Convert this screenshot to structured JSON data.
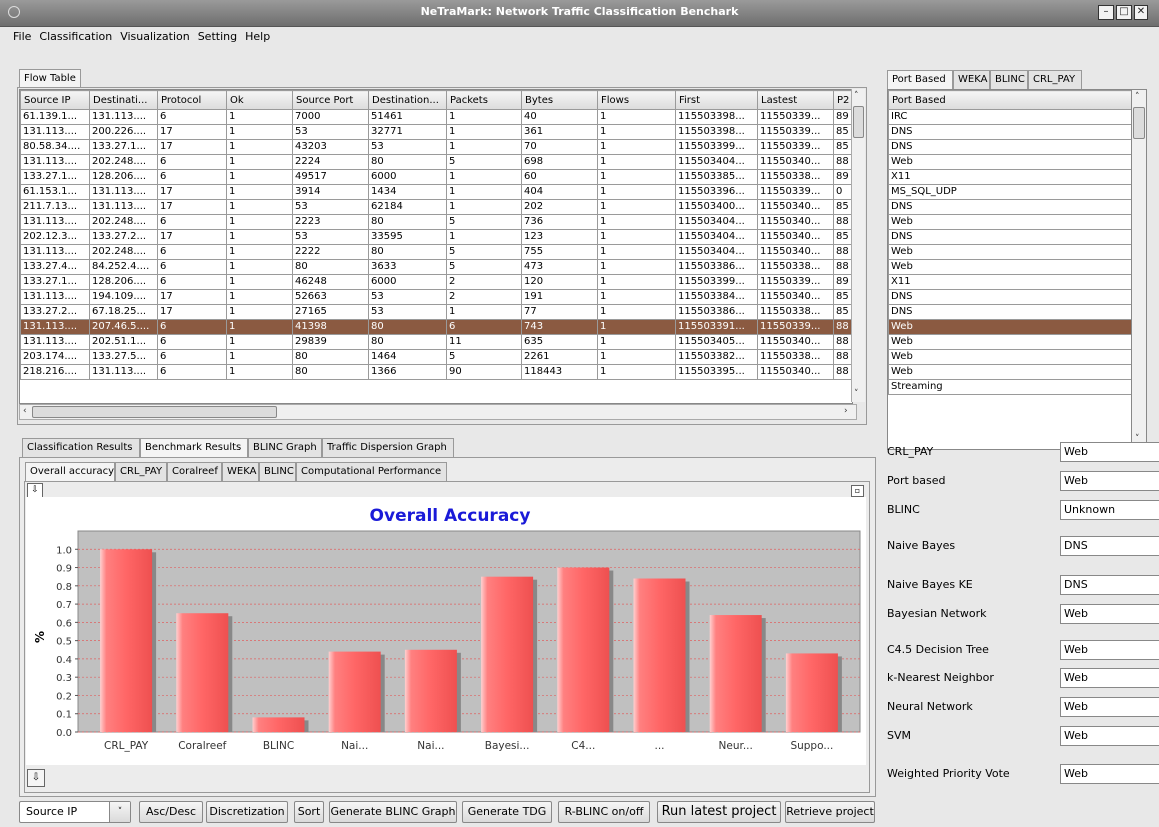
{
  "window": {
    "title": "NeTraMark: Network Traffic Classification Benchark"
  },
  "menu": [
    "File",
    "Classification",
    "Visualization",
    "Setting",
    "Help"
  ],
  "flow_table": {
    "tab": "Flow Table",
    "columns": [
      "Source IP",
      "Destinati...",
      "Protocol",
      "Ok",
      "Source Port",
      "Destination...",
      "Packets",
      "Bytes",
      "Flows",
      "First",
      "Lastest",
      "P2"
    ],
    "rows": [
      [
        "61.139.1...",
        "131.113....",
        "6",
        "1",
        "7000",
        "51461",
        "1",
        "40",
        "1",
        "115503398...",
        "11550339...",
        "89"
      ],
      [
        "131.113....",
        "200.226....",
        "17",
        "1",
        "53",
        "32771",
        "1",
        "361",
        "1",
        "115503398...",
        "11550339...",
        "85"
      ],
      [
        "80.58.34....",
        "133.27.1...",
        "17",
        "1",
        "43203",
        "53",
        "1",
        "70",
        "1",
        "115503399...",
        "11550339...",
        "85"
      ],
      [
        "131.113....",
        "202.248....",
        "6",
        "1",
        "2224",
        "80",
        "5",
        "698",
        "1",
        "115503404...",
        "11550340...",
        "88"
      ],
      [
        "133.27.1...",
        "128.206....",
        "6",
        "1",
        "49517",
        "6000",
        "1",
        "60",
        "1",
        "115503385...",
        "11550338...",
        "89"
      ],
      [
        "61.153.1...",
        "131.113....",
        "17",
        "1",
        "3914",
        "1434",
        "1",
        "404",
        "1",
        "115503396...",
        "11550339...",
        "0"
      ],
      [
        "211.7.13...",
        "131.113....",
        "17",
        "1",
        "53",
        "62184",
        "1",
        "202",
        "1",
        "115503400...",
        "11550340...",
        "85"
      ],
      [
        "131.113....",
        "202.248....",
        "6",
        "1",
        "2223",
        "80",
        "5",
        "736",
        "1",
        "115503404...",
        "11550340...",
        "88"
      ],
      [
        "202.12.3...",
        "133.27.2...",
        "17",
        "1",
        "53",
        "33595",
        "1",
        "123",
        "1",
        "115503404...",
        "11550340...",
        "85"
      ],
      [
        "131.113....",
        "202.248....",
        "6",
        "1",
        "2222",
        "80",
        "5",
        "755",
        "1",
        "115503404...",
        "11550340...",
        "88"
      ],
      [
        "133.27.4...",
        "84.252.4....",
        "6",
        "1",
        "80",
        "3633",
        "5",
        "473",
        "1",
        "115503386...",
        "11550338...",
        "88"
      ],
      [
        "133.27.1...",
        "128.206....",
        "6",
        "1",
        "46248",
        "6000",
        "2",
        "120",
        "1",
        "115503399...",
        "11550339...",
        "89"
      ],
      [
        "131.113....",
        "194.109....",
        "17",
        "1",
        "52663",
        "53",
        "2",
        "191",
        "1",
        "115503384...",
        "11550340...",
        "85"
      ],
      [
        "133.27.2...",
        "67.18.25...",
        "17",
        "1",
        "27165",
        "53",
        "1",
        "77",
        "1",
        "115503386...",
        "11550338...",
        "85"
      ],
      [
        "131.113....",
        "207.46.5....",
        "6",
        "1",
        "41398",
        "80",
        "6",
        "743",
        "1",
        "115503391...",
        "11550339...",
        "88"
      ],
      [
        "131.113....",
        "202.51.1...",
        "6",
        "1",
        "29839",
        "80",
        "11",
        "635",
        "1",
        "115503405...",
        "11550340...",
        "88"
      ],
      [
        "203.174....",
        "133.27.5...",
        "6",
        "1",
        "80",
        "1464",
        "5",
        "2261",
        "1",
        "115503382...",
        "11550338...",
        "88"
      ],
      [
        "218.216....",
        "131.113....",
        "6",
        "1",
        "80",
        "1366",
        "90",
        "118443",
        "1",
        "115503395...",
        "11550340...",
        "88"
      ]
    ],
    "selected_row": 14
  },
  "side_tabs": [
    "Port Based",
    "WEKA",
    "BLINC",
    "CRL_PAY"
  ],
  "port_based": {
    "header": "Port Based",
    "rows": [
      "IRC",
      "DNS",
      "DNS",
      "Web",
      "X11",
      "MS_SQL_UDP",
      "DNS",
      "Web",
      "DNS",
      "Web",
      "Web",
      "X11",
      "DNS",
      "DNS",
      "Web",
      "Web",
      "Web",
      "Web",
      "Streaming"
    ],
    "selected_row": 14
  },
  "results_tabs": [
    "Classification Results",
    "Benchmark Results",
    "BLINC Graph",
    "Traffic Dispersion Graph"
  ],
  "benchmark_tabs": [
    "Overall accuracy",
    "CRL_PAY",
    "Coralreef",
    "WEKA",
    "BLINC",
    "Computational Performance"
  ],
  "chart_data": {
    "type": "bar",
    "title": "Overall Accuracy",
    "xlabel": "",
    "ylabel": "%",
    "categories": [
      "CRL_PAY",
      "Coralreef",
      "BLINC",
      "Nai...",
      "Nai...",
      "Bayesi...",
      "C4...",
      "...",
      "Neur...",
      "Suppo..."
    ],
    "values": [
      1.0,
      0.65,
      0.08,
      0.44,
      0.45,
      0.85,
      0.9,
      0.84,
      0.64,
      0.43
    ],
    "yticks": [
      "0.0",
      "0.1",
      "0.2",
      "0.3",
      "0.4",
      "0.5",
      "0.6",
      "0.7",
      "0.8",
      "0.9",
      "1.0"
    ],
    "ylim": [
      0,
      1.1
    ],
    "grid": true,
    "bar_color": "#ff6666",
    "plot_background": "#c0c0c0"
  },
  "results_fields": [
    {
      "label": "CRL_PAY",
      "value": "Web"
    },
    {
      "label": "Port based",
      "value": "Web"
    },
    {
      "label": "BLINC",
      "value": "Unknown"
    },
    {
      "label": "Naive Bayes",
      "value": "DNS"
    },
    {
      "label": "Naive Bayes KE",
      "value": "DNS"
    },
    {
      "label": "Bayesian Network",
      "value": "Web"
    },
    {
      "label": "C4.5 Decision Tree",
      "value": "Web"
    },
    {
      "label": "k-Nearest Neighbor",
      "value": "Web"
    },
    {
      "label": "Neural Network",
      "value": "Web"
    },
    {
      "label": "SVM",
      "value": "Web"
    },
    {
      "label": "Weighted Priority Vote",
      "value": "Web"
    }
  ],
  "toolbar": {
    "combo_value": "Source IP",
    "asc_desc": "Asc/Desc",
    "discretization": "Discretization",
    "sort": "Sort",
    "gen_blinc": "Generate BLINC Graph",
    "gen_tdg": "Generate TDG",
    "rblinc": "R-BLINC on/off",
    "run_latest": "Run latest project",
    "retrieve": "Retrieve project"
  }
}
